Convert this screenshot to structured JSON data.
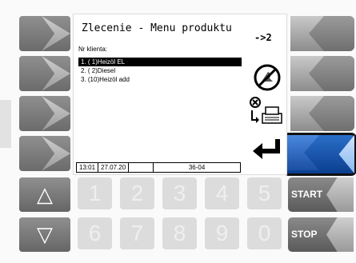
{
  "screen": {
    "title": "Zlecenie - Menu produktu",
    "nav_hint": "->2",
    "client_label": "Nr klienta:",
    "products": [
      {
        "label": "1.  ( 1)Heizöl EL",
        "selected": true
      },
      {
        "label": "2.  ( 2)Diesel",
        "selected": false
      },
      {
        "label": "3.  (10)Heizöl add",
        "selected": false
      }
    ],
    "status": {
      "time": "13:01",
      "date": "27.07.20",
      "blank": "",
      "code": "36-04"
    }
  },
  "keypad": {
    "row1": [
      "1",
      "2",
      "3",
      "4",
      "5"
    ],
    "row2": [
      "6",
      "7",
      "8",
      "9",
      "0"
    ],
    "up": "△",
    "down": "▽",
    "start_label": "START",
    "stop_label": "STOP"
  },
  "colors": {
    "accent_blue": "#1b4fa3",
    "selected_row": "#000000"
  },
  "icons": [
    "no-pump-icon",
    "cancel-print-icon",
    "enter-arrow-icon"
  ]
}
